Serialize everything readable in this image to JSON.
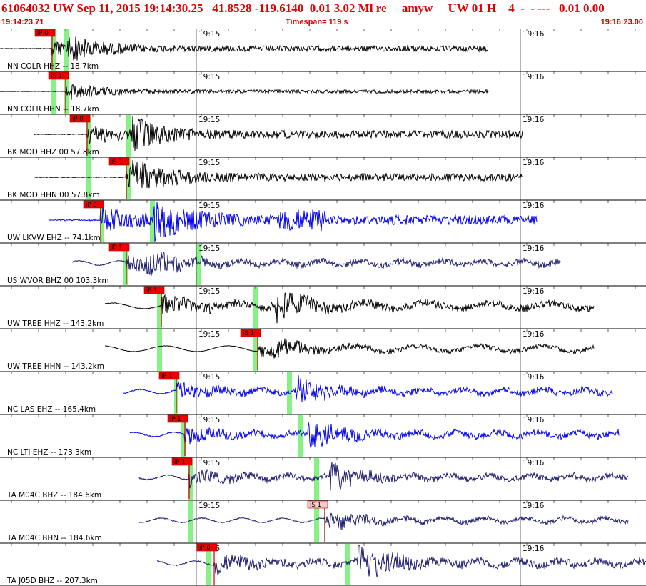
{
  "header": {
    "title": "61064032 UW Sep 11, 2015 19:14:30.25   41.8528 -119.6140  0.01 3.02 Ml re     amyw     UW 01 H    4  -  - ---   0.01 0.00",
    "start_time": "19:14:23.71",
    "timespan": "Timespan= 119 s",
    "end_time": "19:16:23.00"
  },
  "time_ticks": [
    "19:15",
    "19:16"
  ],
  "colors": {
    "title_red": "#e00000",
    "pick_red": "#ee0000",
    "pick_green": "#86f286",
    "trace_black": "#000000",
    "trace_blue": "#0000ee",
    "trace_navy": "#1c1c6e"
  },
  "traces": [
    {
      "label": "NN COLR HHZ -- 18.7km",
      "color": "#000000",
      "picks": [
        {
          "label": "iP 0",
          "style": "red"
        }
      ]
    },
    {
      "label": "NN COLR HHN -- 18.7km",
      "color": "#000000",
      "picks": [
        {
          "label": "iS 1",
          "style": "red"
        }
      ]
    },
    {
      "label": "BK MOD HHZ 00 57.8km",
      "color": "#000000",
      "picks": [
        {
          "label": "iP 0",
          "style": "red"
        }
      ]
    },
    {
      "label": "BK MOD HHN 00 57.8km",
      "color": "#000000",
      "picks": [
        {
          "label": "iS 1",
          "style": "red"
        }
      ]
    },
    {
      "label": "UW LKVW EHZ -- 74.1km",
      "color": "#0000ee",
      "picks": [
        {
          "label": "iP 0",
          "style": "red"
        }
      ]
    },
    {
      "label": "US WVOR BHZ 00 103.3km",
      "color": "#1c1c6e",
      "picks": [
        {
          "label": "iP 1",
          "style": "red"
        }
      ]
    },
    {
      "label": "UW TREE HHZ -- 143.2km",
      "color": "#000000",
      "picks": [
        {
          "label": "iP 1",
          "style": "red"
        }
      ]
    },
    {
      "label": "UW TREE HHN -- 143.2km",
      "color": "#000000",
      "picks": [
        {
          "label": "iS 1",
          "style": "red"
        }
      ]
    },
    {
      "label": "NC LAS EHZ -- 165.4km",
      "color": "#0000ee",
      "picks": [
        {
          "label": "iP 1",
          "style": "red"
        }
      ]
    },
    {
      "label": "NC LTI EHZ -- 173.3km",
      "color": "#0000ee",
      "picks": [
        {
          "label": "iP 1",
          "style": "red"
        }
      ]
    },
    {
      "label": "TA M04C BHZ -- 184.6km",
      "color": "#1c1c6e",
      "picks": [
        {
          "label": "iP 1",
          "style": "red"
        }
      ]
    },
    {
      "label": "TA M04C BHN -- 184.6km",
      "color": "#1c1c6e",
      "picks": [
        {
          "label": "iS 1",
          "style": "pink"
        }
      ]
    },
    {
      "label": "TA J05D BHZ -- 207.3km",
      "color": "#1c1c6e",
      "picks": [
        {
          "label": "iP 0",
          "style": "red"
        }
      ]
    }
  ]
}
